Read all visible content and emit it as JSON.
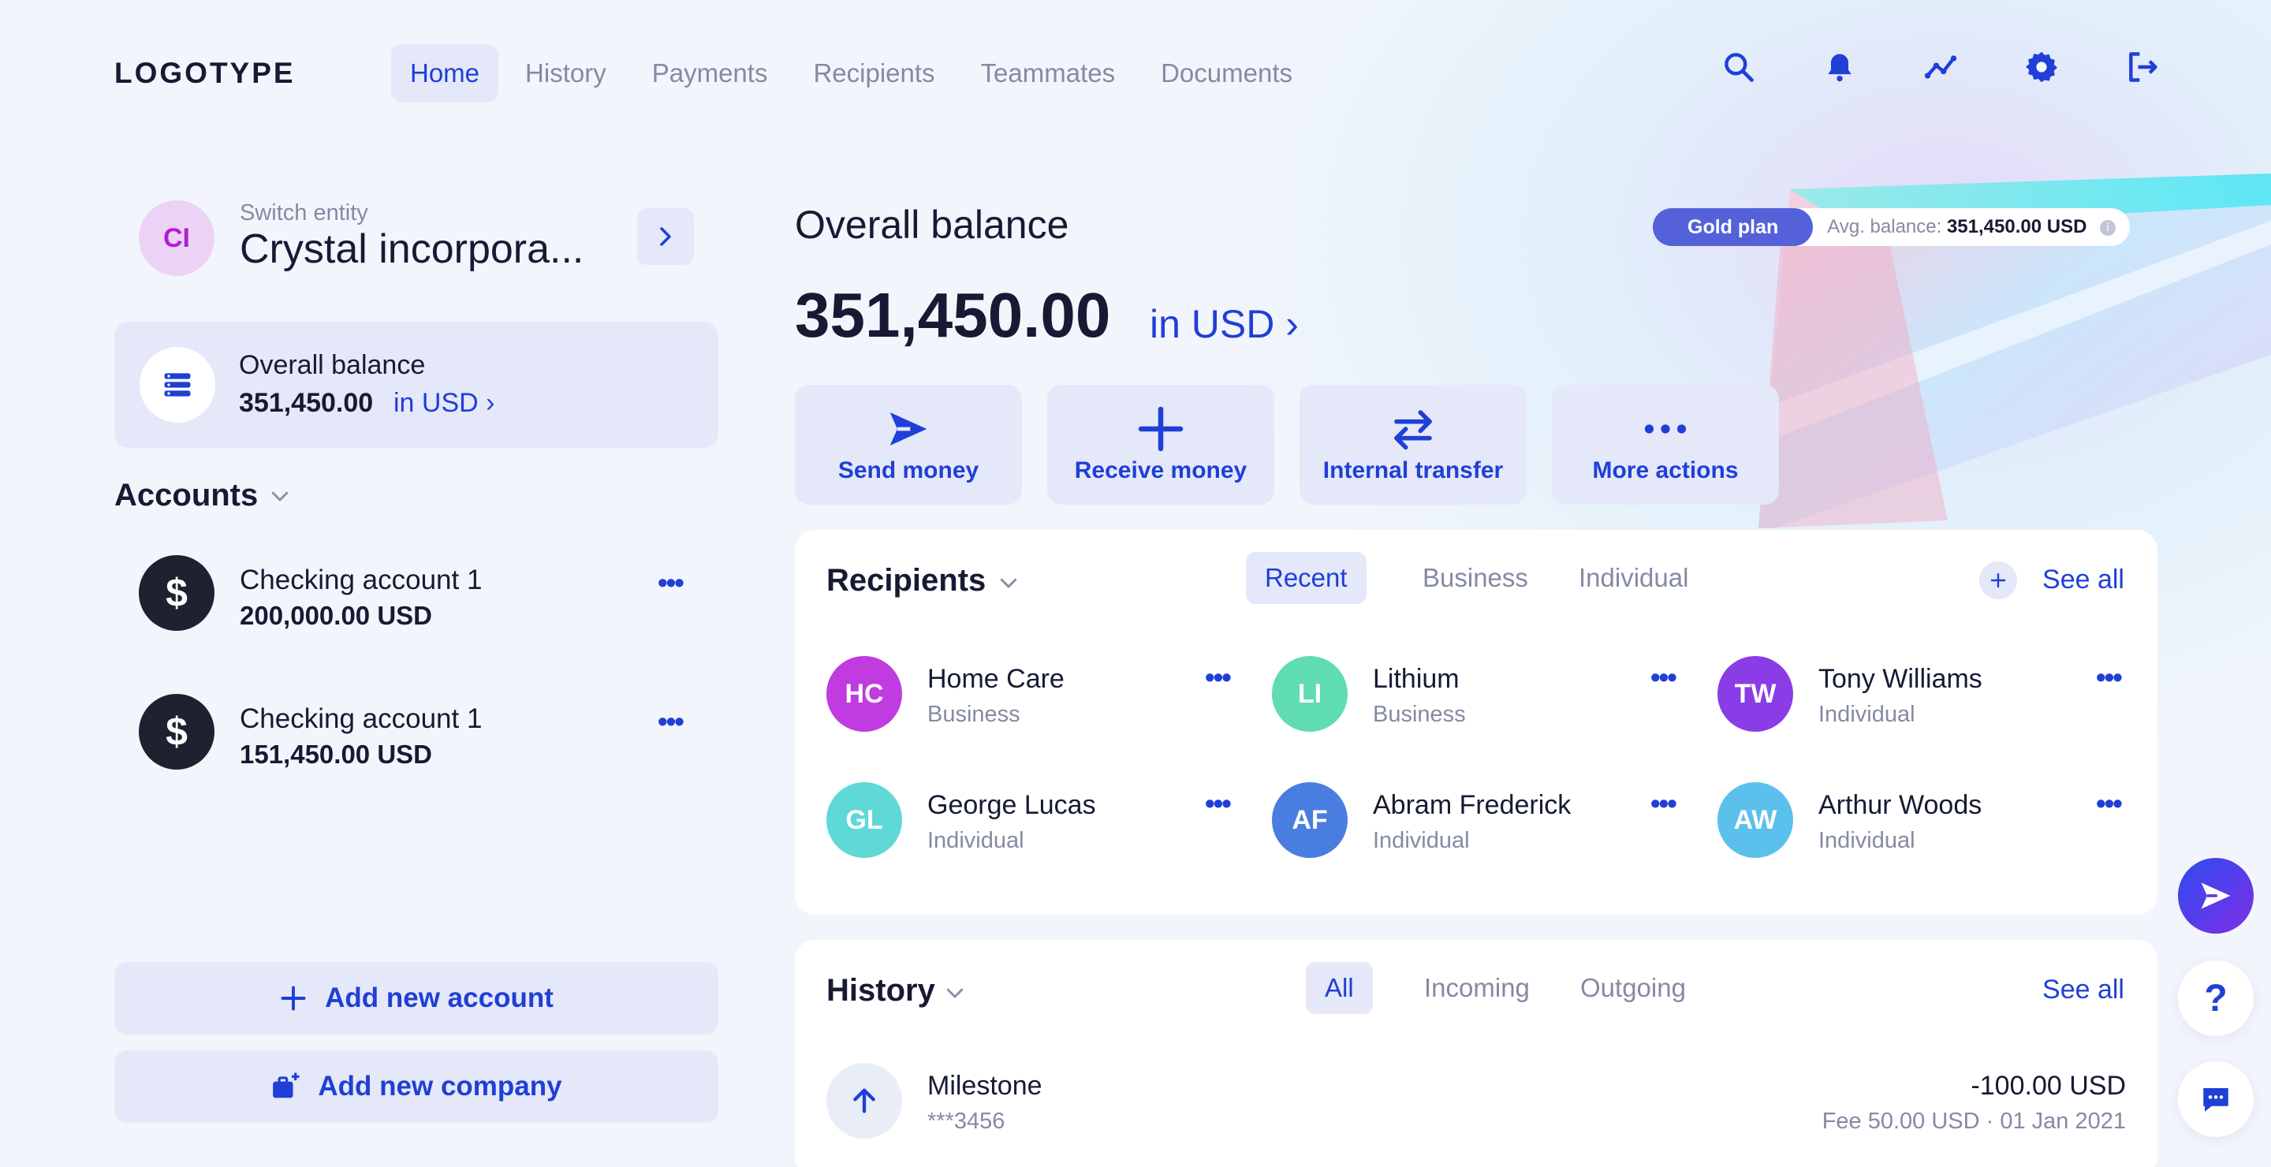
{
  "colors": {
    "accent": "#1f3fd6",
    "text": "#161a33",
    "muted": "#858aa3",
    "tile": "#e4e8f8",
    "plan": "#5561d9"
  },
  "header": {
    "logo": "LOGOTYPE",
    "nav": [
      "Home",
      "History",
      "Payments",
      "Recipients",
      "Teammates",
      "Documents"
    ],
    "active_nav": "Home",
    "icons": [
      "search-icon",
      "bell-icon",
      "analytics-icon",
      "gear-icon",
      "logout-icon"
    ]
  },
  "entity": {
    "initials": "CI",
    "caption": "Switch entity",
    "name": "Crystal incorpora..."
  },
  "balance_card": {
    "title": "Overall balance",
    "value": "351,450.00",
    "currency_link": "in USD ›"
  },
  "accounts": {
    "title": "Accounts",
    "items": [
      {
        "name": "Checking account 1",
        "amount": "200,000.00 USD",
        "more": "•••"
      },
      {
        "name": "Checking account 1",
        "amount": "151,450.00 USD",
        "more": "•••"
      }
    ]
  },
  "left_buttons": {
    "add_account": "Add new account",
    "add_company": "Add new company"
  },
  "overall": {
    "title": "Overall balance",
    "amount": "351,450.00",
    "currency_link": "in USD ›",
    "plan": "Gold plan",
    "avg_label": "Avg. balance:",
    "avg_value": "351,450.00 USD",
    "info": "i"
  },
  "actions": [
    {
      "label": "Send money",
      "icon": "send-icon"
    },
    {
      "label": "Receive money",
      "icon": "plus-icon"
    },
    {
      "label": "Internal transfer",
      "icon": "transfer-icon"
    },
    {
      "label": "More actions",
      "icon": "more-icon"
    }
  ],
  "recipients": {
    "title": "Recipients",
    "tabs": [
      "Recent",
      "Business",
      "Individual"
    ],
    "active_tab": "Recent",
    "see_all": "See all",
    "items": [
      {
        "initials": "HC",
        "name": "Home Care",
        "type": "Business",
        "color": "#c03be0"
      },
      {
        "initials": "LI",
        "name": "Lithium",
        "type": "Business",
        "color": "#5fdcb0"
      },
      {
        "initials": "TW",
        "name": "Tony Williams",
        "type": "Individual",
        "color": "#8a3de6"
      },
      {
        "initials": "GL",
        "name": "George Lucas",
        "type": "Individual",
        "color": "#5fd8d8"
      },
      {
        "initials": "AF",
        "name": "Abram Frederick",
        "type": "Individual",
        "color": "#4a7de0"
      },
      {
        "initials": "AW",
        "name": "Arthur Woods",
        "type": "Individual",
        "color": "#5cc0ec"
      }
    ],
    "more": "•••"
  },
  "history": {
    "title": "History",
    "tabs": [
      "All",
      "Incoming",
      "Outgoing"
    ],
    "active_tab": "All",
    "see_all": "See all",
    "item": {
      "name": "Milestone",
      "account": "***3456",
      "amount": "-100.00 USD",
      "meta": "Fee 50.00 USD · 01 Jan 2021"
    }
  },
  "fabs": {
    "help": "?"
  }
}
